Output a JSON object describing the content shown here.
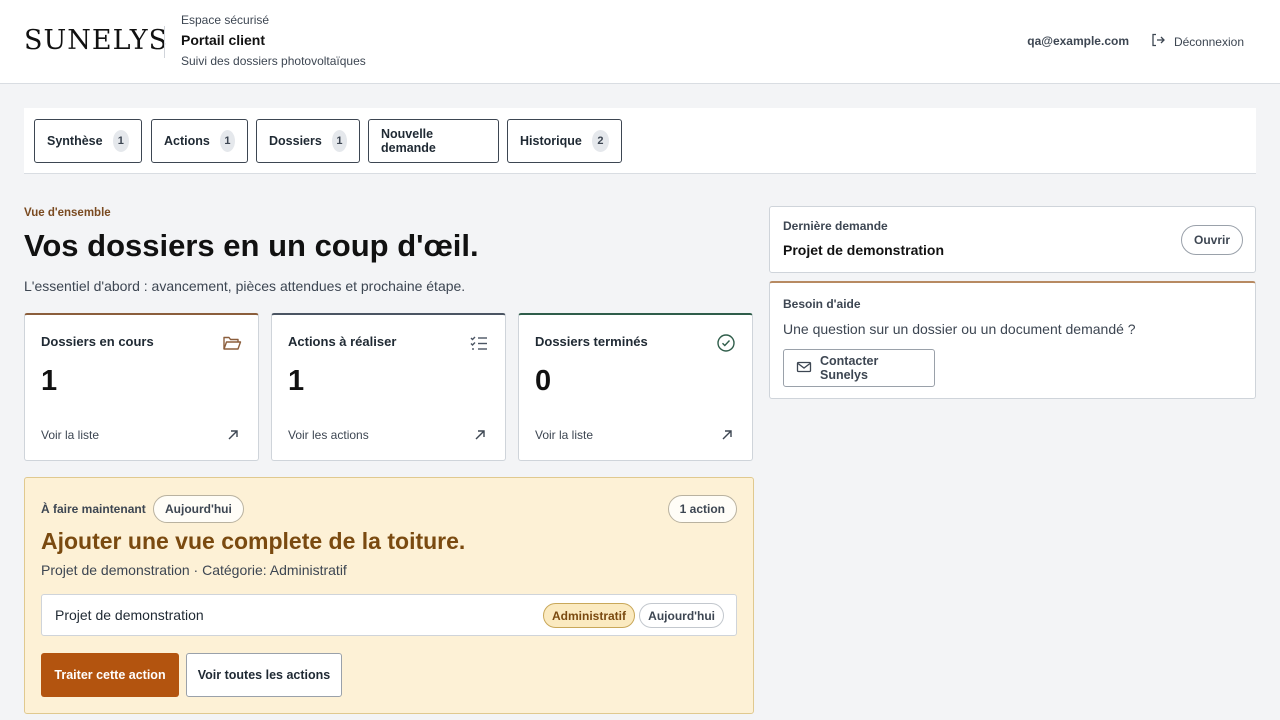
{
  "header": {
    "logo": "SUNELYS",
    "eyebrow": "Espace sécurisé",
    "title": "Portail client",
    "subtitle": "Suivi des dossiers photovoltaïques",
    "user_email": "qa@example.com",
    "logout_label": "Déconnexion"
  },
  "tabs": [
    {
      "label": "Synthèse",
      "count": "1"
    },
    {
      "label": "Actions",
      "count": "1"
    },
    {
      "label": "Dossiers",
      "count": "1"
    },
    {
      "label": "Nouvelle demande"
    },
    {
      "label": "Historique",
      "count": "2"
    }
  ],
  "overview": {
    "eyebrow": "Vue d'ensemble",
    "title": "Vos dossiers en un coup d'œil.",
    "subtitle": "L'essentiel d'abord : avancement, pièces attendues et prochaine étape."
  },
  "stats": [
    {
      "label": "Dossiers en cours",
      "value": "1",
      "link": "Voir la liste",
      "icon": "folder-open-icon"
    },
    {
      "label": "Actions à réaliser",
      "value": "1",
      "link": "Voir les actions",
      "icon": "checklist-icon"
    },
    {
      "label": "Dossiers terminés",
      "value": "0",
      "link": "Voir la liste",
      "icon": "check-circle-icon"
    }
  ],
  "action": {
    "eyebrow": "À faire maintenant",
    "due_pill": "Aujourd'hui",
    "count_pill": "1 action",
    "title": "Ajouter une vue complete de la toiture.",
    "meta": "Projet de demonstration · Catégorie: Administratif",
    "project_name": "Projet de demonstration",
    "category_tag": "Administratif",
    "due_tag": "Aujourd'hui",
    "primary_button": "Traiter cette action",
    "secondary_button": "Voir toutes les actions"
  },
  "last_request": {
    "eyebrow": "Dernière demande",
    "title": "Projet de demonstration",
    "open_button": "Ouvrir"
  },
  "help": {
    "eyebrow": "Besoin d'aide",
    "text": "Une question sur un dossier ou un document demandé ?",
    "contact_button": "Contacter Sunelys"
  },
  "colors": {
    "accent": "#b3540f",
    "action_bg": "#fdf1d6",
    "action_title": "#7a4a10"
  }
}
